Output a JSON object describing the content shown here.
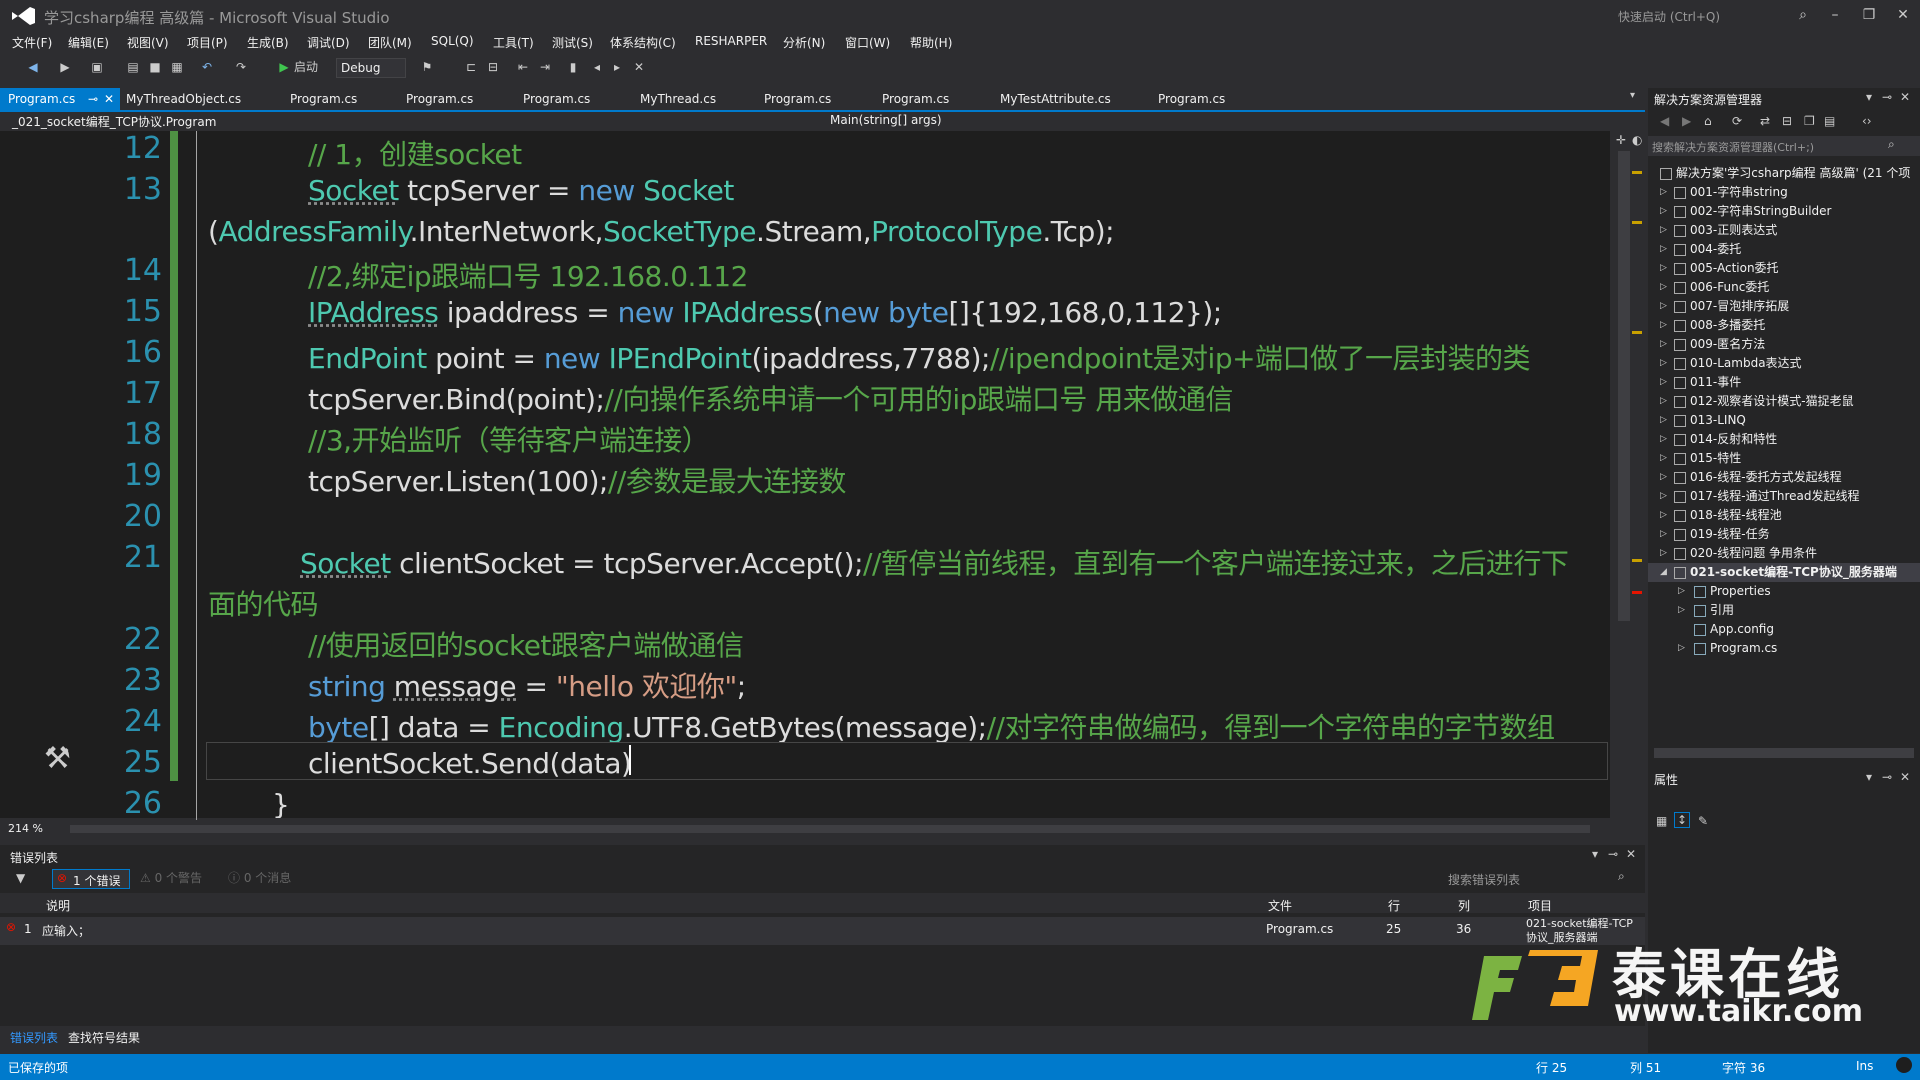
{
  "window": {
    "title": "学习csharp编程 高级篇 - Microsoft Visual Studio",
    "quick_launch": "快速启动 (Ctrl+Q)"
  },
  "menu": [
    "文件(F)",
    "编辑(E)",
    "视图(V)",
    "项目(P)",
    "生成(B)",
    "调试(D)",
    "团队(M)",
    "SQL(Q)",
    "工具(T)",
    "测试(S)",
    "体系结构(C)",
    "RESHARPER",
    "分析(N)",
    "窗口(W)",
    "帮助(H)"
  ],
  "toolbar": {
    "start_label": "启动",
    "config": "Debug"
  },
  "tabs": [
    "Program.cs",
    "MyThreadObject.cs",
    "Program.cs",
    "Program.cs",
    "Program.cs",
    "MyThread.cs",
    "Program.cs",
    "Program.cs",
    "MyTestAttribute.cs",
    "Program.cs"
  ],
  "navbar": {
    "left": "_021_socket编程_TCP协议.Program",
    "right": "Main(string[] args)"
  },
  "editor": {
    "zoom": "214 %",
    "line_numbers": [
      "12",
      "13",
      "",
      "14",
      "15",
      "16",
      "17",
      "18",
      "19",
      "20",
      "21",
      "",
      "22",
      "23",
      "24",
      "25",
      "26"
    ],
    "lines": {
      "l12": "// 1，创建socket",
      "l13": "Socket tcpServer = new Socket",
      "l13b": "(AddressFamily.InterNetwork,SocketType.Stream,ProtocolType.Tcp);",
      "l14": "//2,绑定ip跟端口号 192.168.0.112",
      "l15": "IPAddress ipaddress = new IPAddress(new byte[]{192,168,0,112});",
      "l16": "EndPoint point = new IPEndPoint(ipaddress,7788);//ipendpoint是对ip+端口做了一层封装的类",
      "l17": "tcpServer.Bind(point);//向操作系统申请一个可用的ip跟端口号 用来做通信",
      "l18": "//3,开始监听（等待客户端连接）",
      "l19": "tcpServer.Listen(100);//参数是最大连接数",
      "l21": "Socket clientSocket = tcpServer.Accept();//暂停当前线程，直到有一个客户端连接过来，之后进行下",
      "l21b": "面的代码",
      "l22": "//使用返回的socket跟客户端做通信",
      "l23": "string message = \"hello 欢迎你\";",
      "l24": "byte[] data = Encoding.UTF8.GetBytes(message);//对字符串做编码，得到一个字符串的字节数组",
      "l25": "clientSocket.Send(data)",
      "l26": "}"
    }
  },
  "solution_explorer": {
    "title": "解决方案资源管理器",
    "search_placeholder": "搜索解决方案资源管理器(Ctrl+;)",
    "root": "解决方案'学习csharp编程 高级篇' (21 个项",
    "projects": [
      "001-字符串string",
      "002-字符串StringBuilder",
      "003-正则表达式",
      "004-委托",
      "005-Action委托",
      "006-Func委托",
      "007-冒泡排序拓展",
      "008-多播委托",
      "009-匿名方法",
      "010-Lambda表达式",
      "011-事件",
      "012-观察者设计模式-猫捉老鼠",
      "013-LINQ",
      "014-反射和特性",
      "015-特性",
      "016-线程-委托方式发起线程",
      "017-线程-通过Thread发起线程",
      "018-线程-线程池",
      "019-线程-任务",
      "020-线程问题 争用条件",
      "021-socket编程-TCP协议_服务器端"
    ],
    "children": [
      "Properties",
      "引用",
      "App.config",
      "Program.cs"
    ]
  },
  "properties": {
    "title": "属性"
  },
  "error_list": {
    "title": "错误列表",
    "errors_btn": "1 个错误",
    "warnings_btn": "0 个警告",
    "messages_btn": "0 个消息",
    "search": "搜索错误列表",
    "columns": [
      "说明",
      "文件",
      "行",
      "列",
      "项目"
    ],
    "row": {
      "num": "1",
      "desc": "应输入；",
      "file": "Program.cs",
      "line": "25",
      "col": "36",
      "project": "021-socket编程-TCP协议_服务器端"
    }
  },
  "bottom_tabs": [
    "错误列表",
    "查找符号结果"
  ],
  "status": {
    "left": "已保存的项",
    "row": "行 25",
    "col": "列 51",
    "char": "字符 36",
    "ins": "Ins"
  },
  "watermark": {
    "title": "泰课在线",
    "url": "www.taikr.com"
  },
  "colors": {
    "accent": "#007acc",
    "comment": "#57a64a",
    "keyword": "#569cd6",
    "type": "#4ec9b0",
    "string": "#d69d85",
    "editor_bg": "#1e1e1e"
  }
}
